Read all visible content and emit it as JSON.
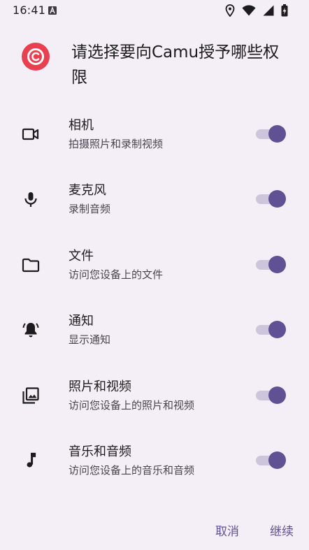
{
  "status_bar": {
    "time": "16:41",
    "icons": [
      "a-badge-icon",
      "location-icon",
      "wifi-icon",
      "signal-icon",
      "battery-charging-icon"
    ]
  },
  "dialog": {
    "title": "请选择要向Camu授予哪些权限",
    "app_icon": "camu-logo-icon",
    "accent_color": "#e8404f"
  },
  "permissions": [
    {
      "icon": "camera-icon",
      "label": "相机",
      "description": "拍摄照片和录制视频",
      "enabled": true
    },
    {
      "icon": "microphone-icon",
      "label": "麦克风",
      "description": "录制音频",
      "enabled": true
    },
    {
      "icon": "folder-icon",
      "label": "文件",
      "description": "访问您设备上的文件",
      "enabled": true
    },
    {
      "icon": "bell-icon",
      "label": "通知",
      "description": "显示通知",
      "enabled": true
    },
    {
      "icon": "photo-library-icon",
      "label": "照片和视频",
      "description": "访问您设备上的照片和视频",
      "enabled": true
    },
    {
      "icon": "music-note-icon",
      "label": "音乐和音频",
      "description": "访问您设备上的音乐和音频",
      "enabled": true
    }
  ],
  "actions": {
    "cancel_label": "取消",
    "continue_label": "继续"
  },
  "colors": {
    "background": "#f4eff6",
    "toggle_thumb": "#5f5193",
    "toggle_track": "#cdc5db",
    "button_text": "#5f5193"
  }
}
